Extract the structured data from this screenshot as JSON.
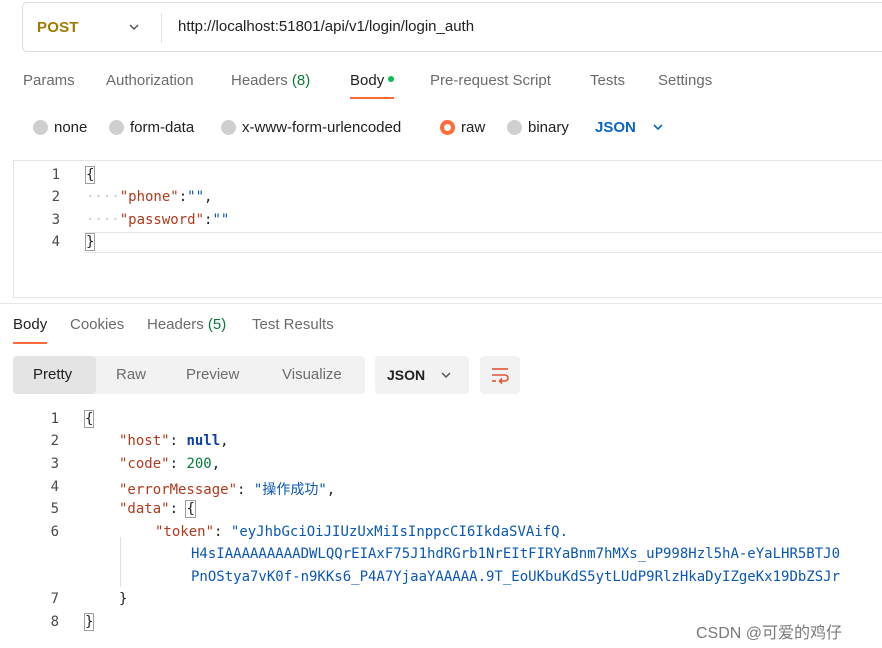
{
  "request": {
    "method": "POST",
    "url": "http://localhost:51801/api/v1/login/login_auth",
    "tabs": {
      "params": "Params",
      "authorization": "Authorization",
      "headers": "Headers",
      "headers_count": "(8)",
      "body": "Body",
      "prerequest": "Pre-request Script",
      "tests": "Tests",
      "settings": "Settings"
    },
    "body_types": {
      "none": "none",
      "form_data": "form-data",
      "urlencoded": "x-www-form-urlencoded",
      "raw": "raw",
      "binary": "binary",
      "selected": "raw",
      "format": "JSON"
    },
    "editor": {
      "line_numbers": [
        "1",
        "2",
        "3",
        "4"
      ],
      "open_brace": "{",
      "close_brace": "}",
      "key1": "\"phone\"",
      "key2": "\"password\"",
      "val1": "\"\"",
      "val2": "\"\"",
      "indent": "····",
      "colon": ":",
      "comma": ","
    }
  },
  "response": {
    "tabs": {
      "body": "Body",
      "cookies": "Cookies",
      "headers": "Headers",
      "headers_count": "(5)",
      "test_results": "Test Results"
    },
    "view_modes": {
      "pretty": "Pretty",
      "raw": "Raw",
      "preview": "Preview",
      "visualize": "Visualize",
      "selected": "Pretty"
    },
    "format": "JSON",
    "line_numbers": [
      "1",
      "2",
      "3",
      "4",
      "5",
      "6",
      "7",
      "8"
    ],
    "code": {
      "open_brace": "{",
      "close_brace": "}",
      "host_key": "\"host\"",
      "host_val": "null",
      "code_key": "\"code\"",
      "code_val": "200",
      "msg_key": "\"errorMessage\"",
      "msg_val": "\"操作成功\"",
      "data_key": "\"data\"",
      "token_key": "\"token\"",
      "token_line1": "\"eyJhbGciOiJIUzUxMiIsInppcCI6IkdaSVAifQ.",
      "token_line2": "H4sIAAAAAAAAADWLQQrEIAxF75J1hdRGrb1NrEItFIRYaBnm7hMXs_uP998Hzl5hA-eYaLHR5BTJ0",
      "token_line3": "PnOStya7vK0f-n9KKs6_P4A7YjaaYAAAAA.9T_EoUKbuKdS5ytLUdP9RlzHkaDyIZgeKx19DbZSJr",
      "colon": ":",
      "comma": ","
    }
  },
  "watermark": "CSDN @可爱的鸡仔",
  "colors": {
    "accent": "#ff6c37",
    "method": "#a07a00",
    "link": "#0b64c4",
    "count": "#0a7a3c"
  }
}
